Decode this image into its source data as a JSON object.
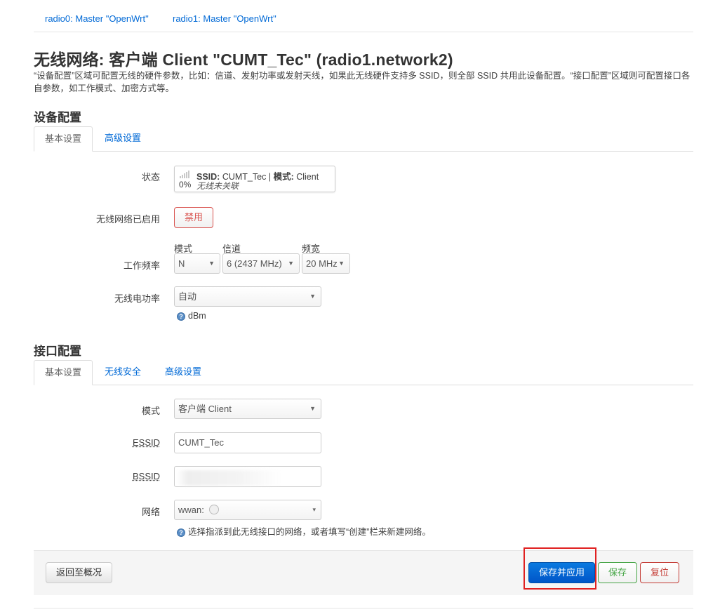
{
  "top_tabs": [
    "radio0: Master \"OpenWrt\"",
    "radio1: Master \"OpenWrt\""
  ],
  "page_title": "无线网络: 客户端 Client \"CUMT_Tec\" (radio1.network2)",
  "description": "“设备配置”区域可配置无线的硬件参数，比如：信道、发射功率或发射天线，如果此无线硬件支持多 SSID，则全部 SSID 共用此设备配置。“接口配置”区域则可配置接口各自参数，如工作模式、加密方式等。",
  "device_section": {
    "title": "设备配置",
    "tabs": [
      "基本设置",
      "高级设置"
    ],
    "status": {
      "label": "状态",
      "ssid_key": "SSID:",
      "ssid_value": "CUMT_Tec",
      "separator": "|",
      "mode_key": "模式:",
      "mode_value": "Client",
      "signal_percent": "0%",
      "assoc_text": "无线未关联"
    },
    "enabled": {
      "label": "无线网络已启用",
      "button": "禁用"
    },
    "frequency": {
      "label": "工作频率",
      "mode_label": "模式",
      "mode_value": "N",
      "channel_label": "信道",
      "channel_value": "6 (2437 MHz)",
      "width_label": "频宽",
      "width_value": "20 MHz"
    },
    "txpower": {
      "label": "无线电功率",
      "value": "自动",
      "unit_hint": "dBm"
    }
  },
  "interface_section": {
    "title": "接口配置",
    "tabs": [
      "基本设置",
      "无线安全",
      "高级设置"
    ],
    "mode": {
      "label": "模式",
      "value": "客户端 Client"
    },
    "essid": {
      "label": "ESSID",
      "value": "CUMT_Tec"
    },
    "bssid": {
      "label": "BSSID",
      "value": ""
    },
    "network": {
      "label": "网络",
      "value": "wwan:",
      "hint": "选择指派到此无线接口的网络，或者填写“创建”栏来新建网络。"
    }
  },
  "footer": {
    "back_button": "返回至概况",
    "save_apply_button": "保存并应用",
    "save_button": "保存",
    "reset_button": "复位"
  },
  "colors": {
    "link": "#0069d6",
    "primary_button": "#0064cd",
    "success": "#46a546",
    "danger": "#c43c35",
    "highlight_box": "#e02020"
  }
}
